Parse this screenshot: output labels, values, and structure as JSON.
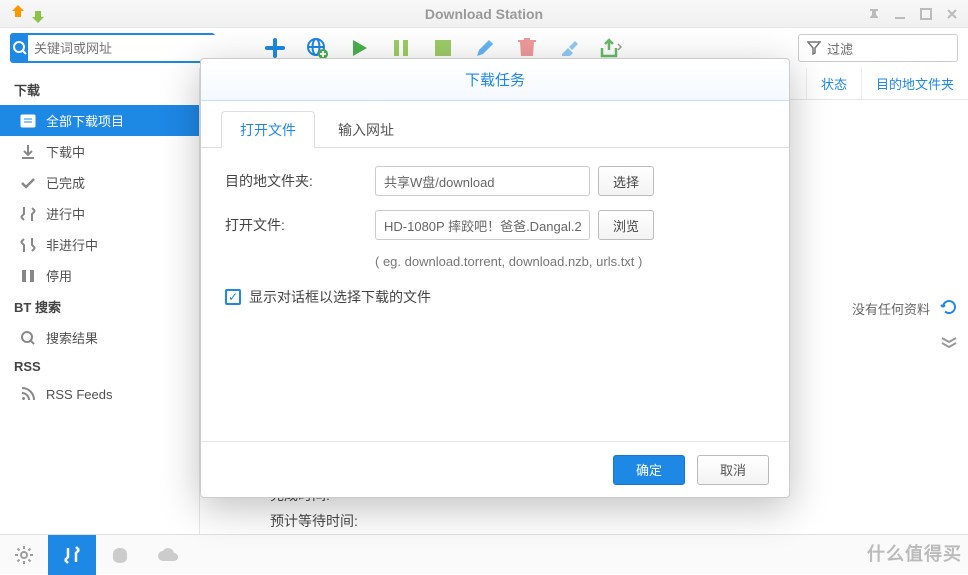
{
  "app": {
    "title": "Download Station"
  },
  "search": {
    "placeholder": "关键词或网址"
  },
  "filter": {
    "placeholder": "过滤"
  },
  "sidebar": {
    "section_download": "下载",
    "items": [
      {
        "label": "全部下载项目"
      },
      {
        "label": "下载中"
      },
      {
        "label": "已完成"
      },
      {
        "label": "进行中"
      },
      {
        "label": "非进行中"
      },
      {
        "label": "停用"
      }
    ],
    "section_bt": "BT 搜索",
    "bt_item": "搜索结果",
    "section_rss": "RSS",
    "rss_item": "RSS Feeds"
  },
  "columns": {
    "status": "状态",
    "dest": "目的地文件夹"
  },
  "empty": {
    "text": "没有任何资料"
  },
  "details": {
    "finish_time": "完成时间:",
    "wait_time": "预计等待时间:"
  },
  "modal": {
    "title": "下载任务",
    "tab_open": "打开文件",
    "tab_url": "输入网址",
    "dest_label": "目的地文件夹:",
    "dest_value": "共享W盘/download",
    "dest_btn": "选择",
    "file_label": "打开文件:",
    "file_value": "HD-1080P 摔跤吧！爸爸.Dangal.2",
    "file_btn": "浏览",
    "hint": "( eg. download.torrent, download.nzb, urls.txt )",
    "checkbox_label": "显示对话框以选择下载的文件",
    "ok": "确定",
    "cancel": "取消"
  },
  "watermark": "什么值得买"
}
